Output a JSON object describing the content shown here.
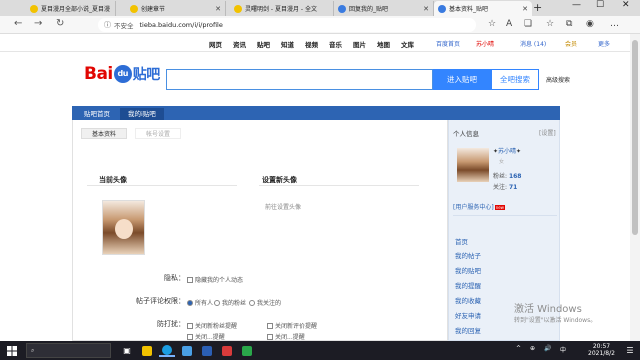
{
  "browser": {
    "tabs": [
      {
        "label": "夏目漫月全部小说_夏目漫",
        "fav": "#f2c200"
      },
      {
        "label": "创建章节",
        "fav": "#f2c200"
      },
      {
        "label": "灵曙明剑 - 夏目漫月 - 全文",
        "fav": "#f2c200"
      },
      {
        "label": "回复我的_贴吧",
        "fav": "#3a7be0"
      },
      {
        "label": "基本资料_贴吧",
        "fav": "#3a7be0"
      }
    ],
    "new_tab": "+",
    "window_min": "—",
    "window_max": "☐",
    "window_close": "✕",
    "nav_back": "←",
    "nav_forward": "→",
    "nav_reload": "↻",
    "insecure_label": "不安全",
    "url": "tieba.baidu.com/i/i/profile"
  },
  "topnav": {
    "items": [
      "网页",
      "资讯",
      "贴吧",
      "知道",
      "视频",
      "音乐",
      "图片",
      "地图",
      "文库"
    ],
    "right": [
      "百度首页",
      "苏小晴",
      "消息 (14)",
      "会员",
      "更多"
    ]
  },
  "header": {
    "logo_text": "Bai",
    "logo_paw": "du",
    "logo_tieba": "贴吧",
    "enter_button": "进入贴吧",
    "all_search_button": "全吧搜索",
    "advanced_search": "高级搜索"
  },
  "bluebar": {
    "items": [
      "贴吧首页",
      "我的i贴吧"
    ]
  },
  "profile": {
    "subtabs": [
      "基本资料",
      "帐号设置"
    ],
    "current_avatar_heading": "当前头像",
    "new_avatar_heading": "设置新头像",
    "set_new_avatar_link": "前往设置头像",
    "form": {
      "hidden_label": "隐私：",
      "hidden_option": "隐藏我的个人动态",
      "comment_label": "帖子评论权限：",
      "comment_options": [
        "所有人",
        "我的粉丝",
        "我关注的"
      ],
      "disturb_label": "防打扰：",
      "disturb_options": [
        "关闭新粉丝提醒",
        "关闭新评价提醒",
        "关闭...提醒",
        "关闭...提醒"
      ]
    }
  },
  "sidebar": {
    "title": "个人信息",
    "settings": "[设置]",
    "name": "苏小晴",
    "gender_hint": "女",
    "fans_label": "粉丝:",
    "fans_value": "168",
    "follow_label": "关注:",
    "follow_value": "71",
    "service_link": "[用户服务中心]",
    "service_badge": "new",
    "links": [
      "首页",
      "我的帖子",
      "我的贴吧",
      "我的提醒",
      "我的收藏",
      "好友申请",
      "我的回复"
    ]
  },
  "activation": {
    "line1": "激活 Windows",
    "line2": "转到\"设置\"以激活 Windows。"
  },
  "taskbar": {
    "search_placeholder": "在这里输入你要搜索的内容",
    "time": "20:57",
    "date": "2021/8/2",
    "tray": [
      "^",
      "⊕",
      "🔊",
      "中"
    ]
  }
}
